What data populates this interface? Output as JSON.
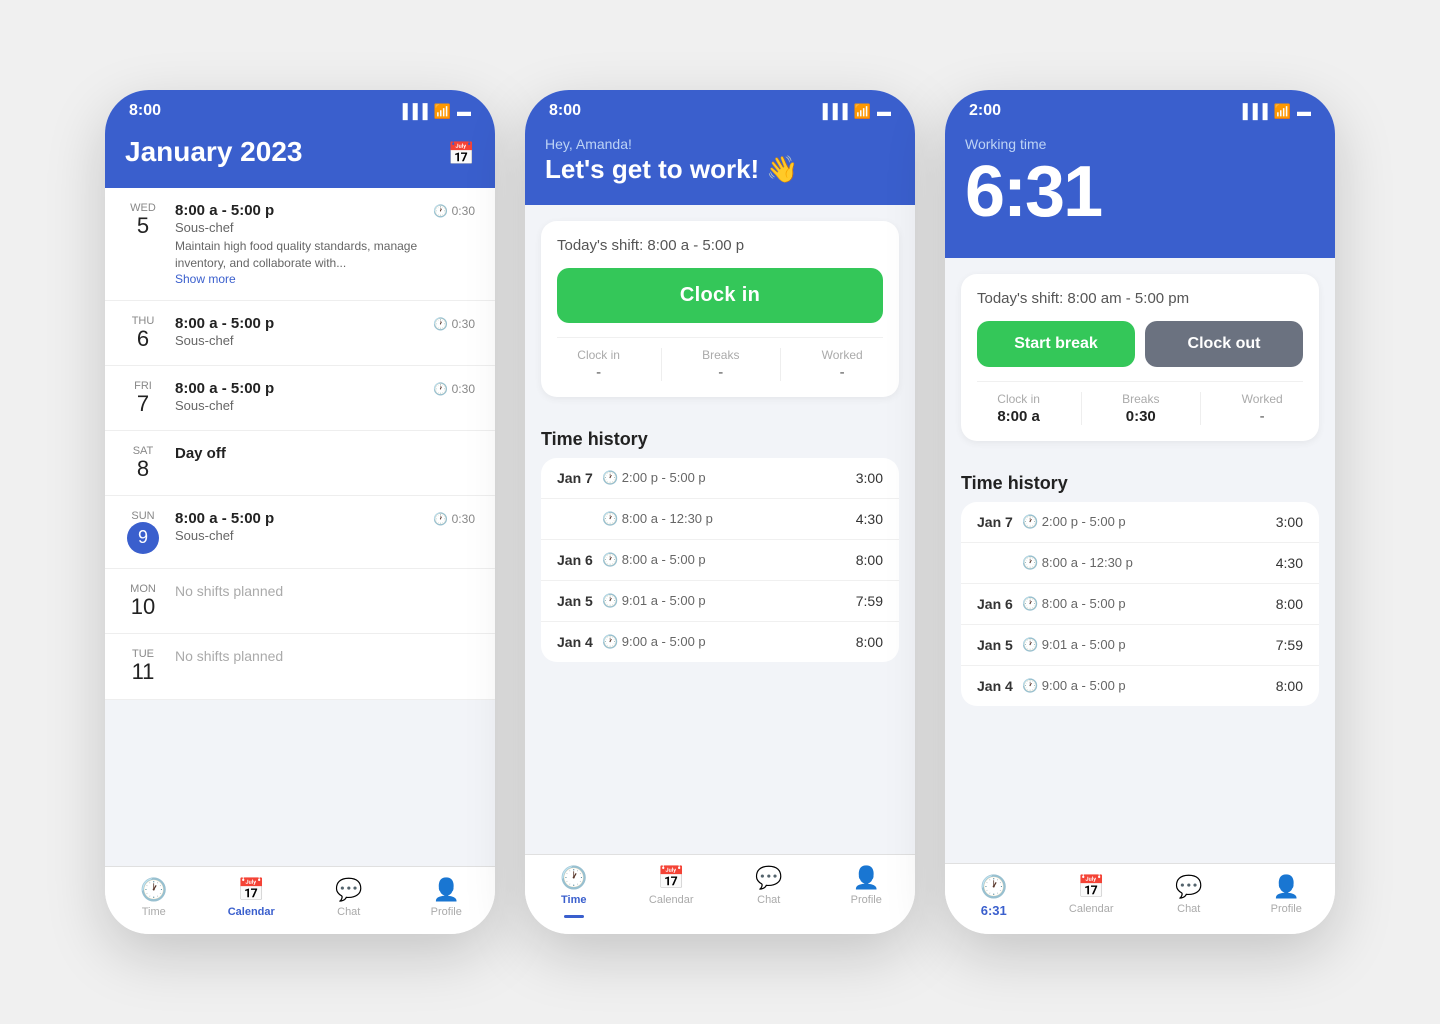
{
  "phone1": {
    "status": {
      "time": "8:00"
    },
    "header": {
      "title": "January 2023"
    },
    "calendar": [
      {
        "dayName": "WED",
        "dayNum": "5",
        "today": false,
        "shiftTime": "8:00 a - 5:00 p",
        "role": "Sous-chef",
        "desc": "Maintain high food quality standards, manage inventory, and collaborate with...",
        "showMore": "Show more",
        "breakTime": "0:30",
        "type": "shift"
      },
      {
        "dayName": "THU",
        "dayNum": "6",
        "today": false,
        "shiftTime": "8:00 a - 5:00 p",
        "role": "Sous-chef",
        "desc": "",
        "breakTime": "0:30",
        "type": "shift"
      },
      {
        "dayName": "FRI",
        "dayNum": "7",
        "today": false,
        "shiftTime": "8:00 a - 5:00 p",
        "role": "Sous-chef",
        "desc": "",
        "breakTime": "0:30",
        "type": "shift"
      },
      {
        "dayName": "SAT",
        "dayNum": "8",
        "today": false,
        "shiftTime": "",
        "role": "",
        "desc": "",
        "breakTime": "",
        "type": "dayoff",
        "label": "Day off"
      },
      {
        "dayName": "SUN",
        "dayNum": "9",
        "today": true,
        "shiftTime": "8:00 a - 5:00 p",
        "role": "Sous-chef",
        "desc": "",
        "breakTime": "0:30",
        "type": "shift"
      },
      {
        "dayName": "MON",
        "dayNum": "10",
        "today": false,
        "shiftTime": "",
        "role": "",
        "desc": "",
        "breakTime": "",
        "type": "noshifts",
        "label": "No shifts planned"
      },
      {
        "dayName": "TUE",
        "dayNum": "11",
        "today": false,
        "shiftTime": "",
        "role": "",
        "desc": "",
        "breakTime": "",
        "type": "noshifts",
        "label": "No shifts planned"
      }
    ],
    "nav": [
      {
        "label": "Time",
        "active": false
      },
      {
        "label": "Calendar",
        "active": true
      },
      {
        "label": "Chat",
        "active": false
      },
      {
        "label": "Profile",
        "active": false
      }
    ]
  },
  "phone2": {
    "status": {
      "time": "8:00"
    },
    "greeting": {
      "small": "Hey, Amanda!",
      "big": "Let's get to work! 👋"
    },
    "shift": "Today's shift: 8:00 a - 5:00 p",
    "clockInBtn": "Clock in",
    "stats": [
      {
        "label": "Clock in",
        "value": "-"
      },
      {
        "label": "Breaks",
        "value": "-"
      },
      {
        "label": "Worked",
        "value": "-"
      }
    ],
    "historyTitle": "Time history",
    "history": [
      {
        "date": "Jan 7",
        "time": "2:00 p - 5:00 p",
        "dur": "3:00",
        "showDate": true
      },
      {
        "date": "",
        "time": "8:00 a - 12:30 p",
        "dur": "4:30",
        "showDate": false
      },
      {
        "date": "Jan 6",
        "time": "8:00 a - 5:00 p",
        "dur": "8:00",
        "showDate": true
      },
      {
        "date": "Jan 5",
        "time": "9:01 a - 5:00 p",
        "dur": "7:59",
        "showDate": true
      },
      {
        "date": "Jan 4",
        "time": "9:00 a - 5:00 p",
        "dur": "8:00",
        "showDate": true
      }
    ],
    "nav": [
      {
        "label": "Time",
        "active": true
      },
      {
        "label": "Calendar",
        "active": false
      },
      {
        "label": "Chat",
        "active": false
      },
      {
        "label": "Profile",
        "active": false
      }
    ]
  },
  "phone3": {
    "status": {
      "time": "2:00"
    },
    "workingLabel": "Working time",
    "timer": "6:31",
    "shift": "Today's shift: 8:00 am - 5:00 pm",
    "startBreakBtn": "Start break",
    "clockOutBtn": "Clock out",
    "stats": [
      {
        "label": "Clock in",
        "value": "8:00 a"
      },
      {
        "label": "Breaks",
        "value": "0:30"
      },
      {
        "label": "Worked",
        "value": "-"
      }
    ],
    "historyTitle": "Time history",
    "history": [
      {
        "date": "Jan 7",
        "time": "2:00 p - 5:00 p",
        "dur": "3:00",
        "showDate": true
      },
      {
        "date": "",
        "time": "8:00 a - 12:30 p",
        "dur": "4:30",
        "showDate": false
      },
      {
        "date": "Jan 6",
        "time": "8:00 a - 5:00 p",
        "dur": "8:00",
        "showDate": true
      },
      {
        "date": "Jan 5",
        "time": "9:01 a - 5:00 p",
        "dur": "7:59",
        "showDate": true
      },
      {
        "date": "Jan 4",
        "time": "9:00 a - 5:00 p",
        "dur": "8:00",
        "showDate": true
      }
    ],
    "nav": [
      {
        "label": "6:31",
        "active": true
      },
      {
        "label": "Calendar",
        "active": false
      },
      {
        "label": "Chat",
        "active": false
      },
      {
        "label": "Profile",
        "active": false
      }
    ]
  },
  "colors": {
    "blue": "#3a5fcd",
    "green": "#34c759",
    "gray": "#6b7280"
  }
}
